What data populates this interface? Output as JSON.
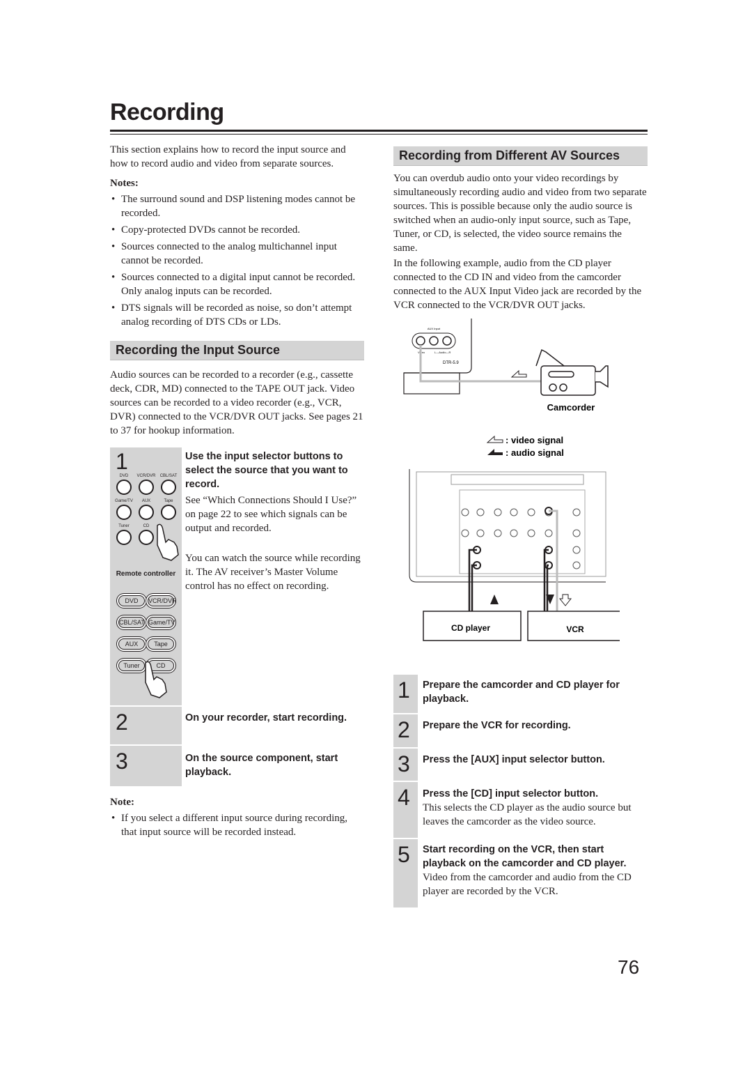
{
  "title": "Recording",
  "intro": "This section explains how to record the input source and how to record audio and video from separate sources.",
  "notes_label": "Notes:",
  "notes": [
    "The surround sound and DSP listening modes cannot be recorded.",
    "Copy-protected DVDs cannot be recorded.",
    "Sources connected to the analog multichannel input cannot be recorded.",
    "Sources connected to a digital input cannot be recorded. Only analog inputs can be recorded.",
    "DTS signals will be recorded as noise, so don’t attempt analog recording of DTS CDs or LDs."
  ],
  "input_source": {
    "heading": "Recording the Input Source",
    "body": "Audio sources can be recorded to a recorder (e.g., cassette deck, CDR, MD) connected to the TAPE OUT jack. Video sources can be recorded to a video recorder (e.g., VCR, DVR) connected to the VCR/DVR OUT jacks. See pages 21 to 37 for hookup information.",
    "steps": [
      {
        "num": "1",
        "title": "Use the input selector buttons to select the source that you want to record.",
        "body": [
          "See “Which Connections Should I Use?” on page 22 to see which signals can be output and recorded.",
          "You can watch the source while recording it. The AV receiver’s Master Volume control has no effect on recording."
        ]
      },
      {
        "num": "2",
        "title": "On your recorder, start recording."
      },
      {
        "num": "3",
        "title": "On the source component, start playback."
      }
    ],
    "panel_buttons": [
      "DVD",
      "VCR/DVR",
      "CBL/SAT",
      "Game/TV",
      "AUX",
      "Tape",
      "Tuner",
      "CD"
    ],
    "remote_label": "Remote controller",
    "remote_buttons": [
      "DVD",
      "VCR/DVR",
      "CBL/SAT",
      "Game/TV",
      "AUX",
      "Tape",
      "Tuner",
      "CD"
    ],
    "note_label": "Note:",
    "note": "If you select a different input source during recording, that input source will be recorded instead."
  },
  "av_sources": {
    "heading": "Recording from Different AV Sources",
    "para1": "You can overdub audio onto your video recordings by simultaneously recording audio and video from two separate sources. This is possible because only the audio source is switched when an audio-only input source, such as Tape, Tuner, or CD, is selected, the video source remains the same.",
    "para2": "In the following example, audio from the CD player connected to the CD IN and video from the camcorder connected to the AUX Input Video jack are recorded by the VCR connected to the VCR/DVR OUT jacks.",
    "diagram": {
      "aux_input": "AUX Input",
      "video": "Video",
      "audio": "L—Audio—R",
      "model": "DTR-5.9",
      "camcorder": "Camcorder",
      "legend_video": "video signal",
      "legend_audio": "audio signal",
      "cd_player": "CD player",
      "vcr": "VCR"
    },
    "steps": [
      {
        "num": "1",
        "title": "Prepare the camcorder and CD player for playback."
      },
      {
        "num": "2",
        "title": "Prepare the VCR for recording."
      },
      {
        "num": "3",
        "title": "Press the [AUX] input selector button."
      },
      {
        "num": "4",
        "title": "Press the [CD] input selector button.",
        "body": "This selects the CD player as the audio source but leaves the camcorder as the video source."
      },
      {
        "num": "5",
        "title": "Start recording on the VCR, then start playback on the camcorder and CD player.",
        "body": "Video from the camcorder and audio from the CD player are recorded by the VCR."
      }
    ]
  },
  "page_number": "76"
}
